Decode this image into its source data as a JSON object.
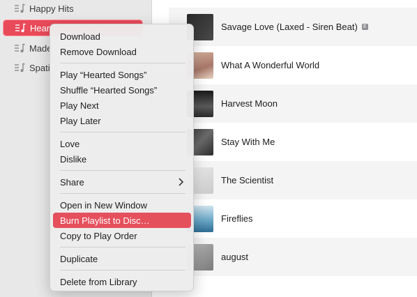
{
  "sidebar": {
    "items": [
      {
        "label": "Happy Hits",
        "icon": "playlist-icon"
      },
      {
        "label": "Hear",
        "icon": "playlist-icon",
        "selected": true
      },
      {
        "label": "Made",
        "icon": "playlist-icon"
      },
      {
        "label": "Spati",
        "icon": "playlist-icon"
      }
    ]
  },
  "tracks": [
    {
      "title": "Savage Love (Laxed - Siren Beat)",
      "explicit": "E"
    },
    {
      "title": "What A Wonderful World"
    },
    {
      "title": "Harvest Moon"
    },
    {
      "title": "Stay With Me"
    },
    {
      "title": "The Scientist"
    },
    {
      "title": "Fireflies"
    },
    {
      "title": "august"
    }
  ],
  "menu": {
    "download": "Download",
    "remove_download": "Remove Download",
    "play": "Play “Hearted Songs”",
    "shuffle": "Shuffle “Hearted Songs”",
    "play_next": "Play Next",
    "play_later": "Play Later",
    "love": "Love",
    "dislike": "Dislike",
    "share": "Share",
    "open_new_window": "Open in New Window",
    "burn": "Burn Playlist to Disc…",
    "copy_play_order": "Copy to Play Order",
    "duplicate": "Duplicate",
    "delete": "Delete from Library"
  },
  "colors": {
    "accent": "#e5505d",
    "sidebar_bg": "#e8e8e8"
  }
}
